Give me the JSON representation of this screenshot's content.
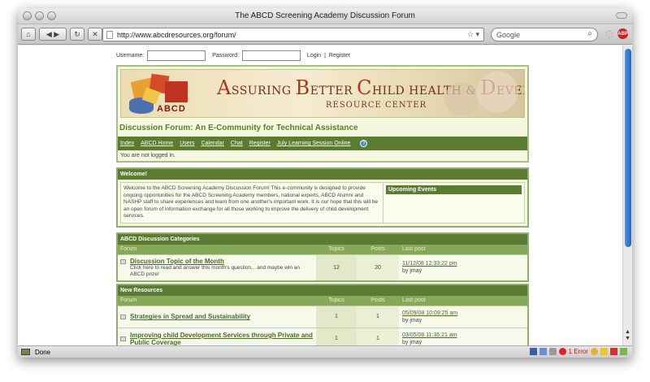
{
  "browser": {
    "window_title": "The ABCD Screening Academy Discussion Forum",
    "url": "http://www.abcdresources.org/forum/",
    "search_placeholder": "Google",
    "status_text": "Done",
    "error_text": "1 Error",
    "abp_label": "ABP",
    "icons": [
      "home-icon",
      "back-icon",
      "forward-icon",
      "reload-icon",
      "stop-icon",
      "star-icon",
      "search-icon",
      "adblock-icon"
    ]
  },
  "login": {
    "username_label": "Username:",
    "password_label": "Password:",
    "username_value": "",
    "password_value": "",
    "login_link": "Login",
    "separator": "|",
    "register_link": "Register"
  },
  "banner": {
    "logo_text": "ABCD",
    "line1_parts": [
      {
        "cap": "A",
        "rest": "SSURING "
      },
      {
        "cap": "B",
        "rest": "ETTER "
      },
      {
        "cap": "C",
        "rest": "HILD HEALTH & "
      },
      {
        "cap": "D",
        "rest": "EVELOPMENT"
      }
    ],
    "line2": "RESOURCE CENTER"
  },
  "forum_title": "Discussion Forum: An E-Community for Technical Assistance",
  "nav": [
    "Index",
    "ABCD Home",
    "Users",
    "Calendar",
    "Chat",
    "Register",
    "July Learning Session Online"
  ],
  "nav_help": "?",
  "not_logged_in": "You are not logged in.",
  "welcome": {
    "heading": "Welcome!",
    "text": "Welcome to the ABCD Screening Academy Discussion Forum! This e-community is designed to provide ongoing opportunities for the ABCD Screening Academy members, national experts, ABCD Alumni and NASHP staff to share experiences and learn from one another's important work. It is our hope that this will be an open forum of information exchange for all those working to improve the delivery of child development services.",
    "events_heading": "Upcoming Events"
  },
  "columns": {
    "forum": "Forum",
    "topics": "Topics",
    "posts": "Posts",
    "last_post": "Last post"
  },
  "categories": {
    "heading": "ABCD Discussion Categories",
    "rows": [
      {
        "title": "Discussion Topic of the Month",
        "desc": "Click here to read and answer this month's question... and maybe win an ABCD prize!",
        "topics": "12",
        "posts": "20",
        "last_date": "11/12/08 12:33:22 pm",
        "last_by": "by jmay"
      }
    ]
  },
  "resources": {
    "heading": "New Resources",
    "rows": [
      {
        "title": "Strategies in Spread and Sustainability",
        "desc": "",
        "topics": "1",
        "posts": "1",
        "last_date": "05/09/08 10:09:25 am",
        "last_by": "by jmay"
      },
      {
        "title": "Improving child Development Services through Private and Public Coverage",
        "desc": "",
        "topics": "1",
        "posts": "1",
        "last_date": "03/05/08 11:36:21 am",
        "last_by": "by jmay"
      }
    ]
  },
  "colors": {
    "nav_green": "#5b7b32",
    "title_green": "#5f7a33",
    "panel_bg": "#f4f8df",
    "banner_red": "#b0341c"
  }
}
